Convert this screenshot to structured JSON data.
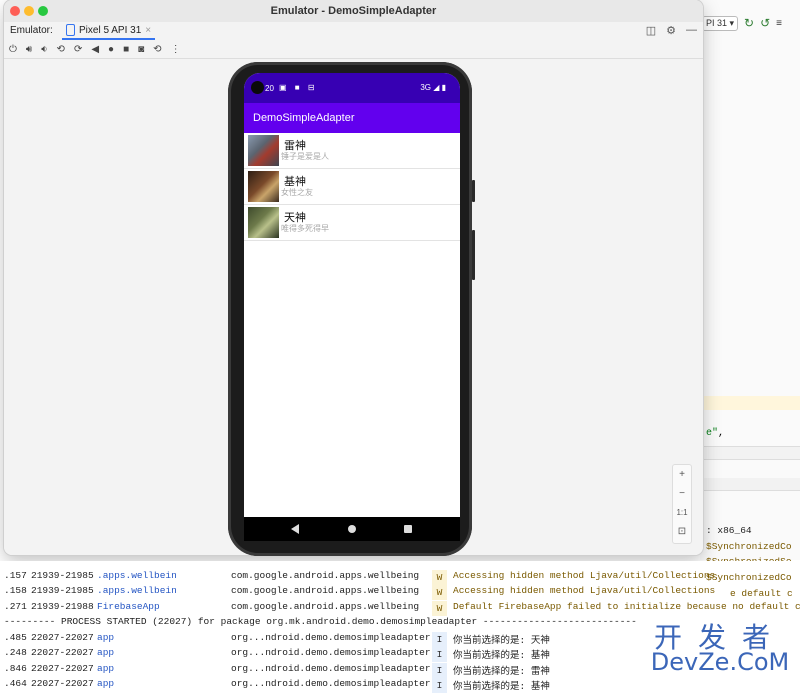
{
  "ide": {
    "device_combo": "PI 31 ▾",
    "code_snippet_string": "e\"",
    "code_snippet_rest": ",",
    "abi_text": ": x86_64",
    "right_lines": [
      "$SynchronizedCo",
      "$SynchronizedSe",
      "$SynchronizedCo",
      "e default c"
    ]
  },
  "emulator": {
    "window_title": "Emulator - DemoSimpleAdapter",
    "tab_prefix": "Emulator:",
    "tab_label": "Pixel 5 API 31",
    "tab_close": "×",
    "zoom": {
      "in": "+",
      "out": "−",
      "actual": "1:1",
      "fit": "⊡"
    }
  },
  "phone": {
    "status_time": "20",
    "status_left_icons": "▣ ■ ⊟",
    "status_right": "3G ◢ ▮",
    "app_title": "DemoSimpleAdapter",
    "items": [
      {
        "name": "雷神",
        "desc": "锤子是爱是人"
      },
      {
        "name": "基神",
        "desc": "女性之友"
      },
      {
        "name": "天神",
        "desc": "唯得多死得早"
      }
    ]
  },
  "log": {
    "rows": [
      {
        "time": ".157",
        "pid": "21939-21985",
        "tag": ".apps.wellbein",
        "pkg": "com.google.android.apps.wellbeing",
        "level": "W",
        "msg": "Accessing hidden method Ljava/util/Collections"
      },
      {
        "time": ".158",
        "pid": "21939-21985",
        "tag": ".apps.wellbein",
        "pkg": "com.google.android.apps.wellbeing",
        "level": "W",
        "msg": "Accessing hidden method Ljava/util/Collections"
      },
      {
        "time": ".271",
        "pid": "21939-21988",
        "tag": "FirebaseApp",
        "pkg": "com.google.android.apps.wellbeing",
        "level": "W",
        "msg": "Default FirebaseApp failed to initialize because no default c"
      }
    ],
    "banner": "--------- PROCESS STARTED (22027) for package org.mk.android.demo.demosimpleadapter ---------------------------",
    "app_rows": [
      {
        "time": ".485",
        "pid": "22027-22027",
        "tag": "app",
        "pkg": "org...ndroid.demo.demosimpleadapter",
        "level": "I",
        "msg": "你当前选择的是: 天神"
      },
      {
        "time": ".248",
        "pid": "22027-22027",
        "tag": "app",
        "pkg": "org...ndroid.demo.demosimpleadapter",
        "level": "I",
        "msg": "你当前选择的是: 基神"
      },
      {
        "time": ".846",
        "pid": "22027-22027",
        "tag": "app",
        "pkg": "org...ndroid.demo.demosimpleadapter",
        "level": "I",
        "msg": "你当前选择的是: 雷神"
      },
      {
        "time": ".464",
        "pid": "22027-22027",
        "tag": "app",
        "pkg": "org...ndroid.demo.demosimpleadapter",
        "level": "I",
        "msg": "你当前选择的是: 基神"
      }
    ]
  },
  "watermark": {
    "cn": "开发者",
    "en": "DevZe.CoM"
  }
}
